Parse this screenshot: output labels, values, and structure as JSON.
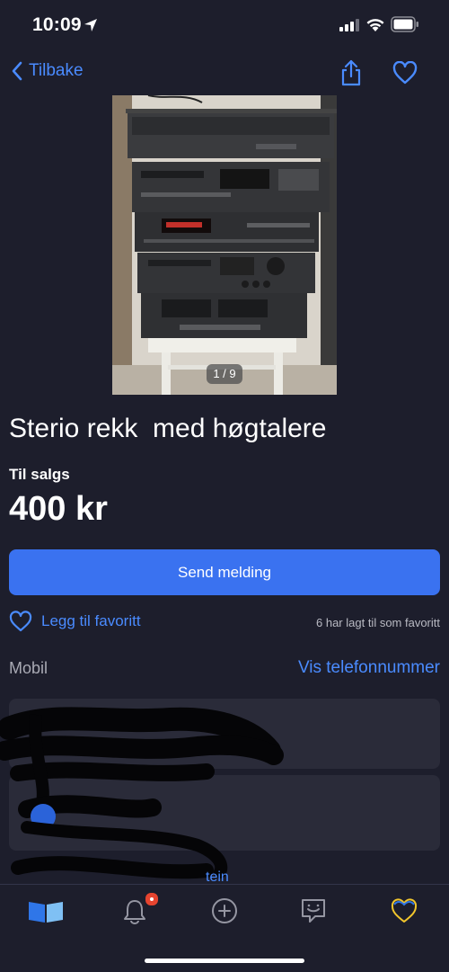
{
  "status": {
    "time": "10:09"
  },
  "nav": {
    "back_label": "Tilbake"
  },
  "photo": {
    "counter": "1 / 9"
  },
  "listing": {
    "title": "Sterio rekk  med høgtalere",
    "sale_label": "Til salgs",
    "price": "400 kr"
  },
  "actions": {
    "send_label": "Send melding",
    "favorite_label": "Legg til favoritt",
    "favorite_count": "6 har lagt til som favoritt"
  },
  "contact": {
    "phone_label": "Mobil",
    "phone_link": "Vis telefonnummer"
  },
  "peek": {
    "link_fragment": "tein"
  },
  "tabs": [
    "home-icon",
    "notifications-icon",
    "new-ad-icon",
    "messages-icon",
    "favorites-icon"
  ],
  "colors": {
    "accent": "#3a72f0",
    "link": "#4a8bff",
    "background": "#1d1e2c",
    "card": "#2a2b39",
    "badge": "#e6442f"
  }
}
